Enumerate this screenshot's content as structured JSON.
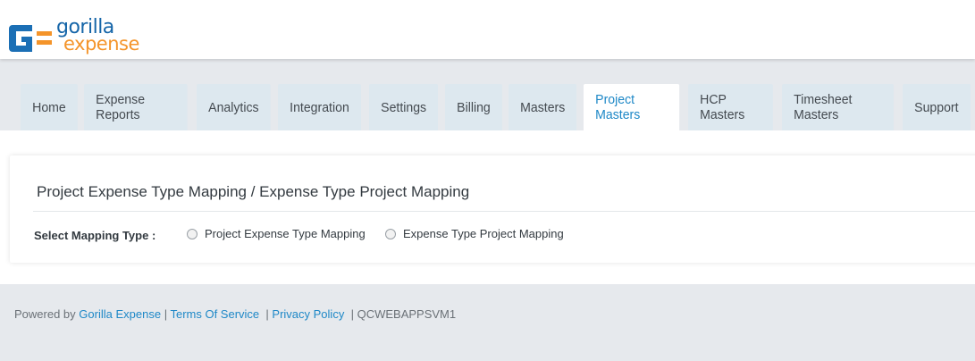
{
  "header": {
    "logo": {
      "line1": "gorilla",
      "line2": "expense"
    }
  },
  "nav": {
    "tabs": [
      {
        "label": "Home",
        "active": false
      },
      {
        "label": "Expense Reports",
        "active": false
      },
      {
        "label": "Analytics",
        "active": false
      },
      {
        "label": "Integration",
        "active": false
      },
      {
        "label": "Settings",
        "active": false
      },
      {
        "label": "Billing",
        "active": false
      },
      {
        "label": "Masters",
        "active": false
      },
      {
        "label": "Project Masters",
        "active": true
      },
      {
        "label": "HCP Masters",
        "active": false
      },
      {
        "label": "Timesheet Masters",
        "active": false
      },
      {
        "label": "Support",
        "active": false
      }
    ]
  },
  "main": {
    "title": "Project Expense Type Mapping / Expense Type Project Mapping",
    "mapping_label": "Select Mapping Type :",
    "options": [
      {
        "label": "Project Expense Type Mapping",
        "selected": false
      },
      {
        "label": "Expense Type Project Mapping",
        "selected": false
      }
    ]
  },
  "footer": {
    "powered_by": "Powered by",
    "brand_link": "Gorilla Expense",
    "sep1": "|",
    "terms_link": "Terms Of Service",
    "sep2": "|",
    "privacy_link": "Privacy Policy",
    "sep3": "|",
    "server": "QCWEBAPPSVM1"
  },
  "colors": {
    "brand_blue": "#1565a8",
    "brand_orange": "#f4942a",
    "link_blue": "#1e88c7",
    "tab_bg": "#dde8ef"
  }
}
